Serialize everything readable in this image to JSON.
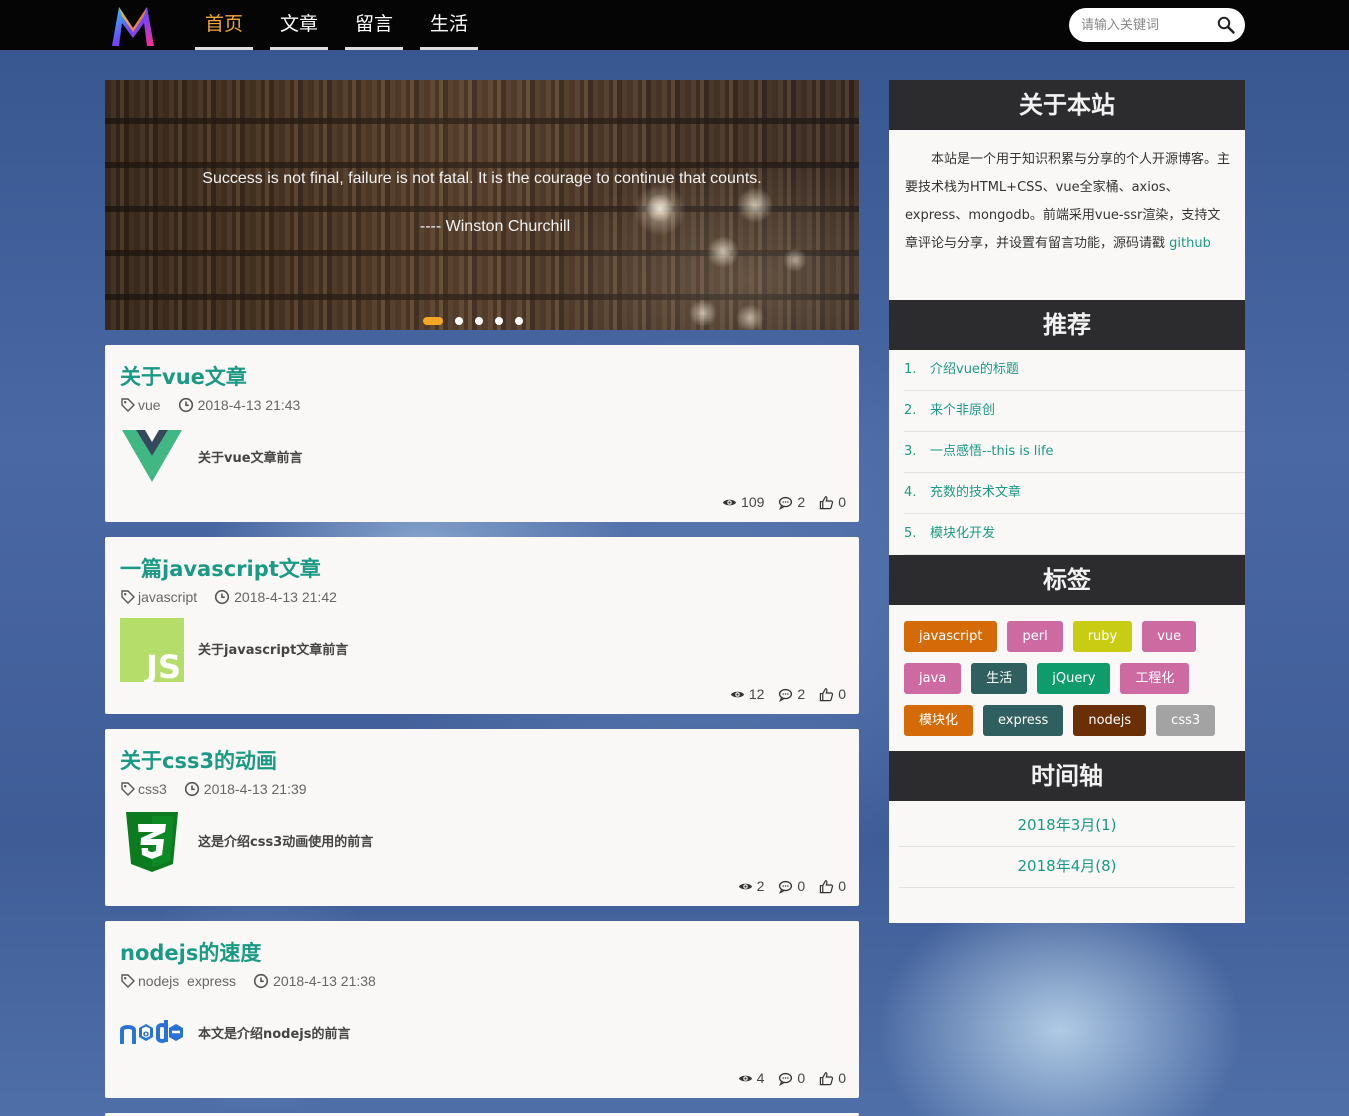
{
  "header": {
    "nav": [
      {
        "label": "首页",
        "active": true
      },
      {
        "label": "文章",
        "active": false
      },
      {
        "label": "留言",
        "active": false
      },
      {
        "label": "生活",
        "active": false
      }
    ],
    "search_placeholder": "请输入关键词",
    "colors": {
      "bar": "#050505",
      "active_nav": "#f3a63a"
    }
  },
  "carousel": {
    "quote": "Success is not final, failure is not fatal. It is the courage to continue that counts.",
    "author": "---- Winston Churchill",
    "slide_count": 5,
    "active_slide": 1
  },
  "articles": [
    {
      "title": "关于vue文章",
      "tags": "vue",
      "date": "2018-4-13 21:43",
      "excerpt": "关于vue文章前言",
      "thumb_icon": "vue-logo-icon",
      "views": "109",
      "comments": "2",
      "likes": "0"
    },
    {
      "title": "一篇javascript文章",
      "tags": "javascript",
      "date": "2018-4-13 21:42",
      "excerpt": "关于javascript文章前言",
      "thumb_icon": "js-logo-icon",
      "views": "12",
      "comments": "2",
      "likes": "0"
    },
    {
      "title": "关于css3的动画",
      "tags": "css3",
      "date": "2018-4-13 21:39",
      "excerpt": "这是介绍css3动画使用的前言",
      "thumb_icon": "css3-logo-icon",
      "views": "2",
      "comments": "0",
      "likes": "0"
    },
    {
      "title": "nodejs的速度",
      "tags": "nodejs  express",
      "date": "2018-4-13 21:38",
      "excerpt": "本文是介绍nodejs的前言",
      "thumb_icon": "nodejs-logo-icon",
      "views": "4",
      "comments": "0",
      "likes": "0"
    }
  ],
  "sidebar": {
    "about": {
      "heading": "关于本站",
      "text": "本站是一个用于知识积累与分享的个人开源博客。主要技术栈为HTML+CSS、vue全家桶、axios、express、mongodb。前端采用vue-ssr渲染，支持文章评论与分享，并设置有留言功能，源码请戳 ",
      "link": "github"
    },
    "recommend": {
      "heading": "推荐",
      "items": [
        {
          "num": "1.",
          "label": "介绍vue的标题"
        },
        {
          "num": "2.",
          "label": "来个非原创"
        },
        {
          "num": "3.",
          "label": "一点感悟--this is life"
        },
        {
          "num": "4.",
          "label": "充数的技术文章"
        },
        {
          "num": "5.",
          "label": "模块化开发"
        }
      ]
    },
    "tags": {
      "heading": "标签",
      "rows": [
        [
          {
            "label": "javascript",
            "color": "#d46b08"
          },
          {
            "label": "perl",
            "color": "#cd6aa2"
          },
          {
            "label": "ruby",
            "color": "#c8cc12"
          },
          {
            "label": "vue",
            "color": "#cd6aa2"
          }
        ],
        [
          {
            "label": "java",
            "color": "#cd6aa2"
          },
          {
            "label": "生活",
            "color": "#2f5f5e"
          },
          {
            "label": "jQuery",
            "color": "#0e9c6d"
          },
          {
            "label": "工程化",
            "color": "#cd6aa2"
          }
        ],
        [
          {
            "label": "模块化",
            "color": "#d46b08"
          },
          {
            "label": "express",
            "color": "#2f5f5e"
          },
          {
            "label": "nodejs",
            "color": "#6b2f06"
          },
          {
            "label": "css3",
            "color": "#a3a3a3"
          }
        ]
      ]
    },
    "timeline": {
      "heading": "时间轴",
      "items": [
        {
          "label": "2018年3月(1)"
        },
        {
          "label": "2018年4月(8)"
        }
      ]
    }
  }
}
